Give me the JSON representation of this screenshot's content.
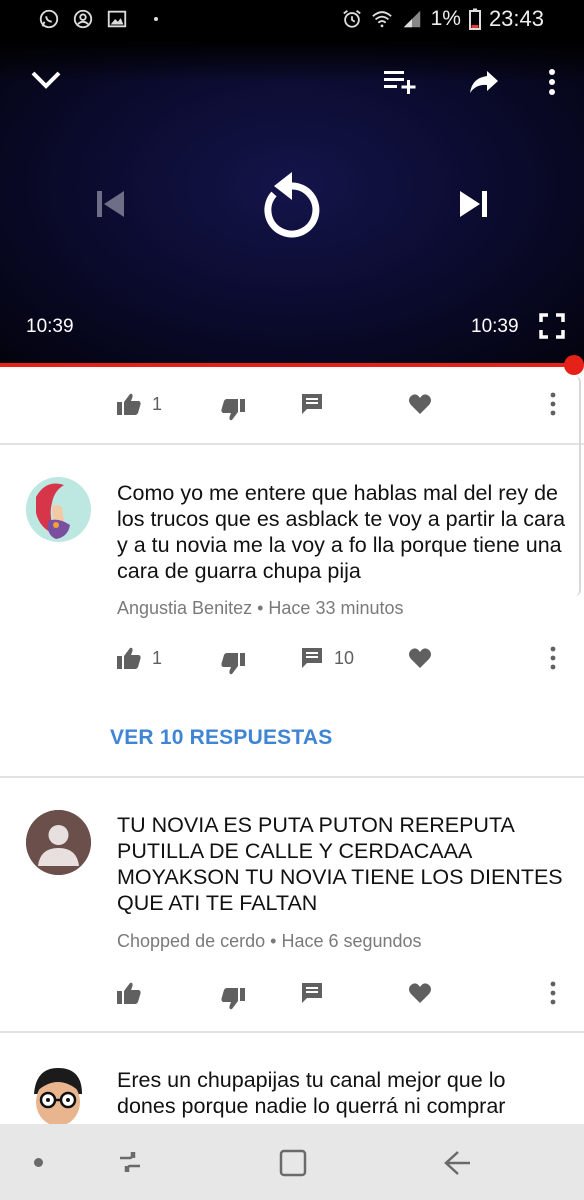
{
  "status_bar": {
    "left_icons": [
      "whatsapp-icon",
      "account-circle-icon",
      "image-icon",
      "dot-icon"
    ],
    "battery": "1%",
    "time": "23:43"
  },
  "player": {
    "elapsed": "10:39",
    "duration": "10:39",
    "progress": 1.0,
    "accent": "#e62117",
    "controls": [
      "collapse-icon",
      "add-to-playlist-icon",
      "share-icon",
      "more-vert-icon",
      "skip-previous-icon",
      "replay-icon",
      "skip-next-icon",
      "fullscreen-icon"
    ]
  },
  "video_actions": {
    "likes": "1"
  },
  "comments": [
    {
      "text": "Como yo me entere que hablas mal del rey de los trucos que es asblack te voy a partir la cara y a tu novia me la voy a fo lla porque tiene una cara de guarra chupa pija",
      "author": "Angustia Benitez",
      "time": "Hace 33 minutos",
      "likes": "1",
      "replies_count": "10",
      "view_replies": "VER 10 RESPUESTAS"
    },
    {
      "text": "TU NOVIA ES PUTA PUTON REREPUTA PUTILLA DE CALLE Y CERDACAAA MOYAKSON TU NOVIA TIENE LOS DIENTES QUE ATI TE FALTAN",
      "author": "Chopped de cerdo",
      "time": "Hace 6 segundos"
    },
    {
      "text": "Eres un chupapijas tu canal mejor que lo dones porque nadie lo querrá ni comprar"
    }
  ],
  "nav_bar": {
    "buttons": [
      "dot-icon",
      "recent-apps-icon",
      "home-icon",
      "back-icon"
    ]
  }
}
